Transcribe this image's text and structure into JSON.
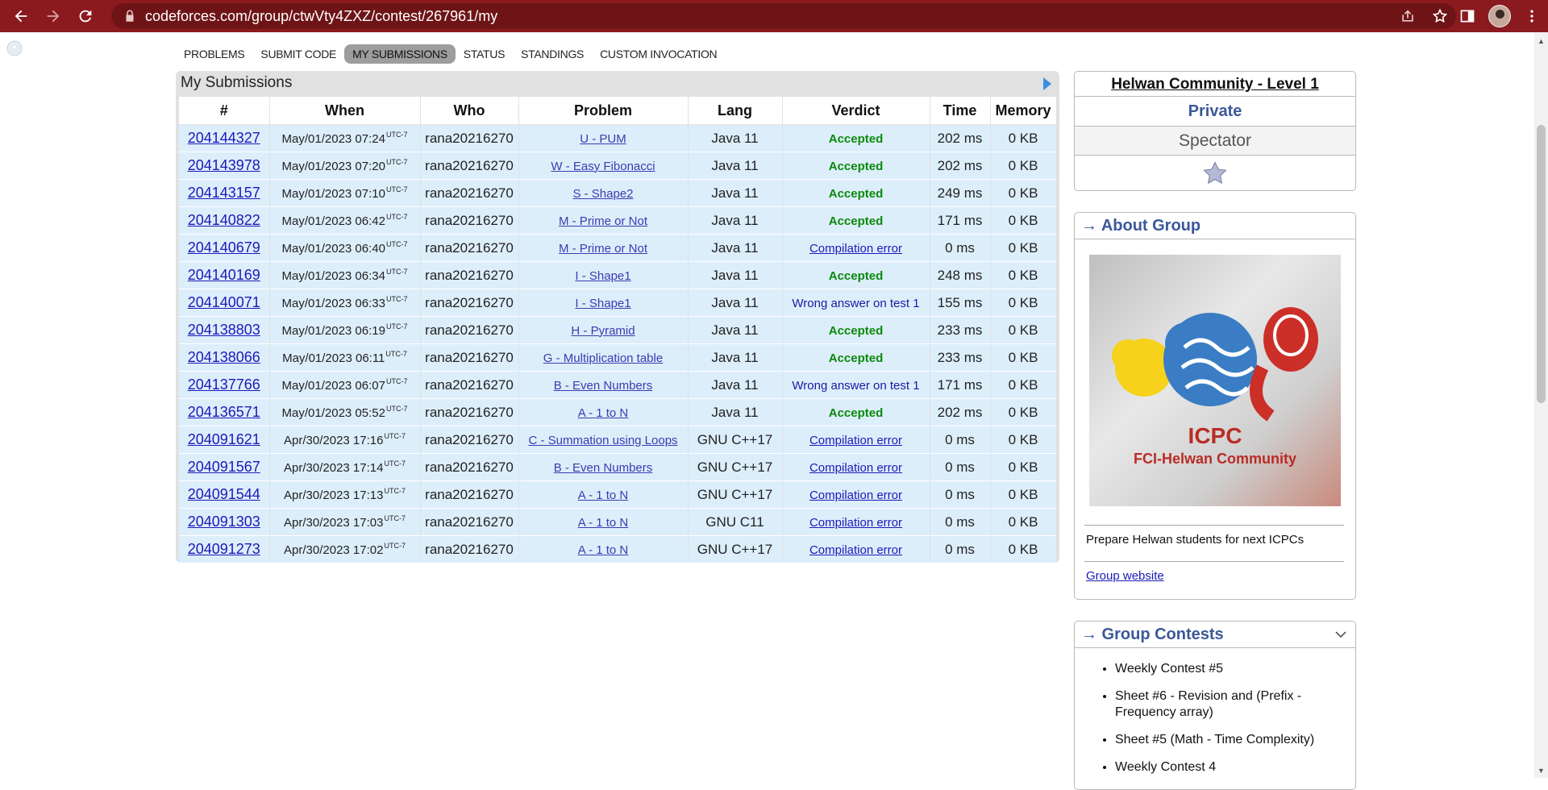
{
  "browser": {
    "url": "codeforces.com/group/ctwVty4ZXZ/contest/267961/my"
  },
  "menu": {
    "items": [
      "PROBLEMS",
      "SUBMIT CODE",
      "MY SUBMISSIONS",
      "STATUS",
      "STANDINGS",
      "CUSTOM INVOCATION"
    ],
    "active": "MY SUBMISSIONS"
  },
  "submissions": {
    "caption": "My Submissions",
    "columns": [
      "#",
      "When",
      "Who",
      "Problem",
      "Lang",
      "Verdict",
      "Time",
      "Memory"
    ],
    "tz": "UTC-7",
    "rows": [
      {
        "id": "204144327",
        "when": "May/01/2023 07:24",
        "who": "rana20216270",
        "problem": "U - PUM",
        "lang": "Java 11",
        "verdict": "Accepted",
        "time": "202 ms",
        "memory": "0 KB"
      },
      {
        "id": "204143978",
        "when": "May/01/2023 07:20",
        "who": "rana20216270",
        "problem": "W - Easy Fibonacci",
        "lang": "Java 11",
        "verdict": "Accepted",
        "time": "202 ms",
        "memory": "0 KB"
      },
      {
        "id": "204143157",
        "when": "May/01/2023 07:10",
        "who": "rana20216270",
        "problem": "S - Shape2",
        "lang": "Java 11",
        "verdict": "Accepted",
        "time": "249 ms",
        "memory": "0 KB"
      },
      {
        "id": "204140822",
        "when": "May/01/2023 06:42",
        "who": "rana20216270",
        "problem": "M - Prime or Not",
        "lang": "Java 11",
        "verdict": "Accepted",
        "time": "171 ms",
        "memory": "0 KB"
      },
      {
        "id": "204140679",
        "when": "May/01/2023 06:40",
        "who": "rana20216270",
        "problem": "M - Prime or Not",
        "lang": "Java 11",
        "verdict": "Compilation error",
        "time": "0 ms",
        "memory": "0 KB"
      },
      {
        "id": "204140169",
        "when": "May/01/2023 06:34",
        "who": "rana20216270",
        "problem": "I - Shape1",
        "lang": "Java 11",
        "verdict": "Accepted",
        "time": "248 ms",
        "memory": "0 KB"
      },
      {
        "id": "204140071",
        "when": "May/01/2023 06:33",
        "who": "rana20216270",
        "problem": "I - Shape1",
        "lang": "Java 11",
        "verdict": "Wrong answer on test 1",
        "time": "155 ms",
        "memory": "0 KB"
      },
      {
        "id": "204138803",
        "when": "May/01/2023 06:19",
        "who": "rana20216270",
        "problem": "H - Pyramid",
        "lang": "Java 11",
        "verdict": "Accepted",
        "time": "233 ms",
        "memory": "0 KB"
      },
      {
        "id": "204138066",
        "when": "May/01/2023 06:11",
        "who": "rana20216270",
        "problem": "G - Multiplication table",
        "lang": "Java 11",
        "verdict": "Accepted",
        "time": "233 ms",
        "memory": "0 KB"
      },
      {
        "id": "204137766",
        "when": "May/01/2023 06:07",
        "who": "rana20216270",
        "problem": "B - Even Numbers",
        "lang": "Java 11",
        "verdict": "Wrong answer on test 1",
        "time": "171 ms",
        "memory": "0 KB"
      },
      {
        "id": "204136571",
        "when": "May/01/2023 05:52",
        "who": "rana20216270",
        "problem": "A - 1 to N",
        "lang": "Java 11",
        "verdict": "Accepted",
        "time": "202 ms",
        "memory": "0 KB"
      },
      {
        "id": "204091621",
        "when": "Apr/30/2023 17:16",
        "who": "rana20216270",
        "problem": "C - Summation using Loops",
        "lang": "GNU C++17",
        "verdict": "Compilation error",
        "time": "0 ms",
        "memory": "0 KB"
      },
      {
        "id": "204091567",
        "when": "Apr/30/2023 17:14",
        "who": "rana20216270",
        "problem": "B - Even Numbers",
        "lang": "GNU C++17",
        "verdict": "Compilation error",
        "time": "0 ms",
        "memory": "0 KB"
      },
      {
        "id": "204091544",
        "when": "Apr/30/2023 17:13",
        "who": "rana20216270",
        "problem": "A - 1 to N",
        "lang": "GNU C++17",
        "verdict": "Compilation error",
        "time": "0 ms",
        "memory": "0 KB"
      },
      {
        "id": "204091303",
        "when": "Apr/30/2023 17:03",
        "who": "rana20216270",
        "problem": "A - 1 to N",
        "lang": "GNU C11",
        "verdict": "Compilation error",
        "time": "0 ms",
        "memory": "0 KB"
      },
      {
        "id": "204091273",
        "when": "Apr/30/2023 17:02",
        "who": "rana20216270",
        "problem": "A - 1 to N",
        "lang": "GNU C++17",
        "verdict": "Compilation error",
        "time": "0 ms",
        "memory": "0 KB"
      }
    ]
  },
  "group": {
    "name": "Helwan Community - Level 1",
    "privacy": "Private",
    "role": "Spectator"
  },
  "about": {
    "title": "→ About Group",
    "logo_text_1": "ICPC",
    "logo_text_2": "FCI-Helwan Community",
    "description": "Prepare Helwan students for next ICPCs",
    "link": "Group website"
  },
  "contests": {
    "title": "→ Group Contests",
    "items": [
      "Weekly Contest #5",
      "Sheet #6 - Revision and (Prefix - Frequency array)",
      "Sheet #5 (Math - Time Complexity)",
      "Weekly Contest 4"
    ]
  },
  "colors": {
    "chrome": "#8b1a1f",
    "accepted": "#0a8a0a",
    "link": "#1a1ab8",
    "row_bg": "#ddeefb",
    "box_title": "#3b5998"
  }
}
